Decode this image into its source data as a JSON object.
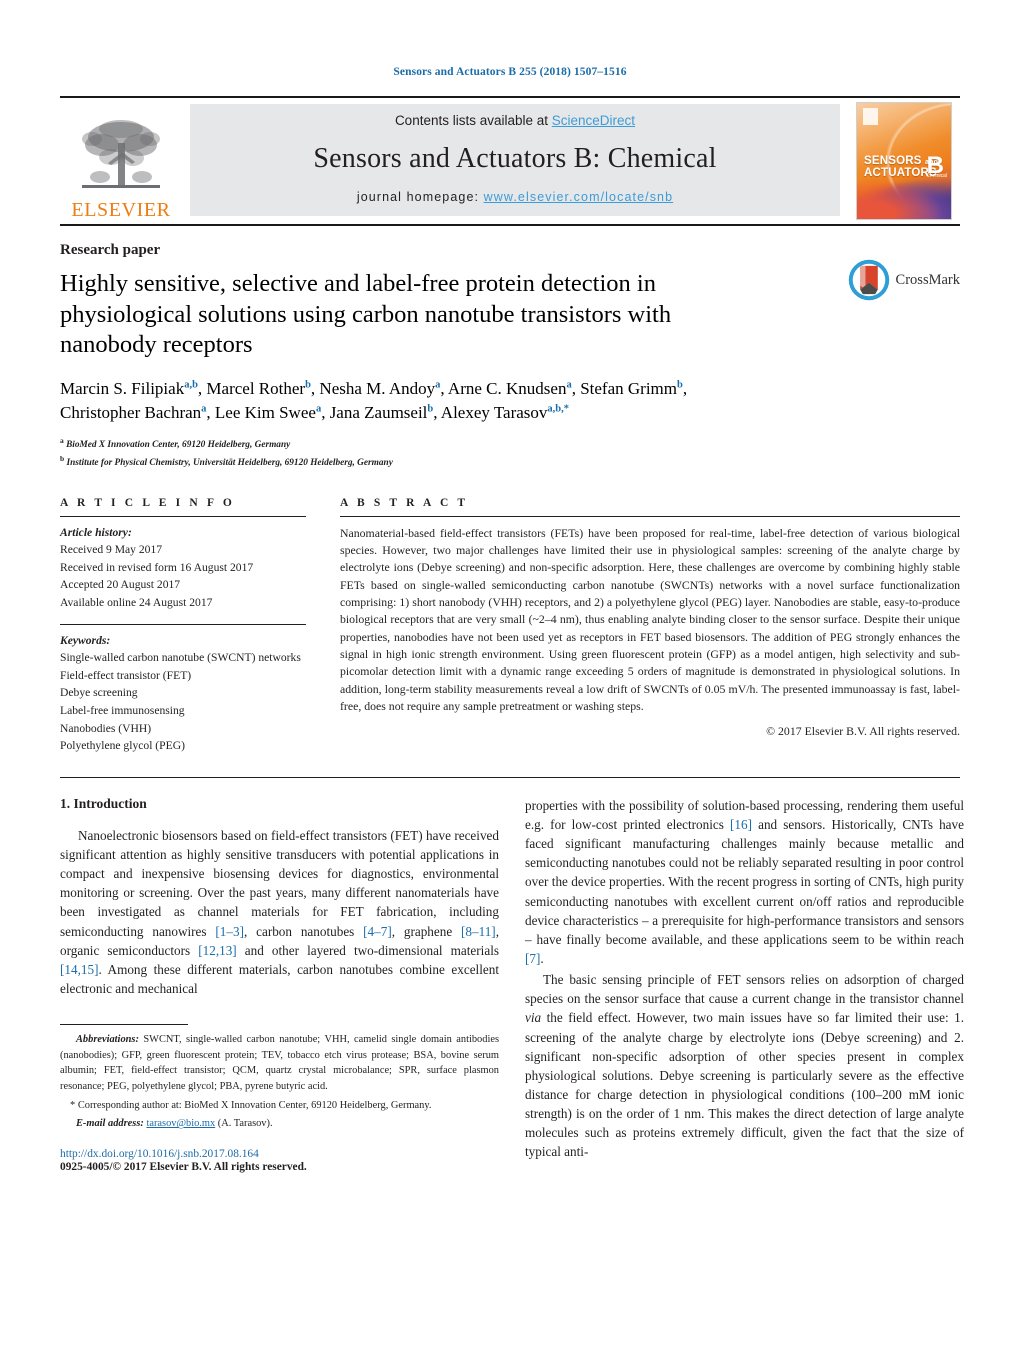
{
  "running_head": "Sensors and Actuators B 255 (2018) 1507–1516",
  "masthead": {
    "publisher": "ELSEVIER",
    "contents_prefix": "Contents lists available at ",
    "contents_link": "ScienceDirect",
    "journal_title": "Sensors and Actuators B: Chemical",
    "homepage_prefix": "journal homepage: ",
    "homepage_url": "www.elsevier.com/locate/snb",
    "cover": {
      "line1": "SENSORS",
      "line1_small": "and",
      "line2": "ACTUATORS",
      "letter": "B",
      "letter_sub": "Chemical"
    },
    "link_color": "#3c9cd7",
    "band_color": "#e6e7e8",
    "elsevier_orange": "#ee7d11"
  },
  "article": {
    "kind": "Research paper",
    "title": "Highly sensitive, selective and label-free protein detection in physiological solutions using carbon nanotube transistors with nanobody receptors",
    "crossmark_label": "CrossMark",
    "authors_html": "Marcin S. Filipiak<sup>a,b</sup>, Marcel Rother<sup>b</sup>, Nesha M. Andoy<sup>a</sup>, Arne C. Knudsen<sup>a</sup>, Stefan Grimm<sup>b</sup>, Christopher Bachran<sup>a</sup>, Lee Kim Swee<sup>a</sup>, Jana Zaumseil<sup>b</sup>, Alexey Tarasov<sup>a,b,<span>*</span></sup>",
    "affiliations": [
      "BioMed X Innovation Center, 69120 Heidelberg, Germany",
      "Institute for Physical Chemistry, Universität Heidelberg, 69120 Heidelberg, Germany"
    ],
    "affiliation_marks": [
      "a",
      "b"
    ]
  },
  "article_info": {
    "heading": "A R T I C L E   I N F O",
    "history_label": "Article history:",
    "history": [
      "Received 9 May 2017",
      "Received in revised form 16 August 2017",
      "Accepted 20 August 2017",
      "Available online 24 August 2017"
    ],
    "keywords_label": "Keywords:",
    "keywords": [
      "Single-walled carbon nanotube (SWCNT) networks",
      "Field-effect transistor (FET)",
      "Debye screening",
      "Label-free immunosensing",
      "Nanobodies (VHH)",
      "Polyethylene glycol (PEG)"
    ]
  },
  "abstract": {
    "heading": "A B S T R A C T",
    "text": "Nanomaterial-based field-effect transistors (FETs) have been proposed for real-time, label-free detection of various biological species. However, two major challenges have limited their use in physiological samples: screening of the analyte charge by electrolyte ions (Debye screening) and non-specific adsorption. Here, these challenges are overcome by combining highly stable FETs based on single-walled semiconducting carbon nanotube (SWCNTs) networks with a novel surface functionalization comprising: 1) short nanobody (VHH) receptors, and 2) a polyethylene glycol (PEG) layer. Nanobodies are stable, easy-to-produce biological receptors that are very small (~2–4 nm), thus enabling analyte binding closer to the sensor surface. Despite their unique properties, nanobodies have not been used yet as receptors in FET based biosensors. The addition of PEG strongly enhances the signal in high ionic strength environment. Using green fluorescent protein (GFP) as a model antigen, high selectivity and sub-picomolar detection limit with a dynamic range exceeding 5 orders of magnitude is demonstrated in physiological solutions. In addition, long-term stability measurements reveal a low drift of SWCNTs of 0.05 mV/h. The presented immunoassay is fast, label-free, does not require any sample pretreatment or washing steps.",
    "copyright": "© 2017 Elsevier B.V. All rights reserved."
  },
  "body": {
    "section_heading": "1.  Introduction",
    "para1_html": "Nanoelectronic biosensors based on field-effect transistors (FET) have received significant attention as highly sensitive transducers with potential applications in compact and inexpensive biosensing devices for diagnostics, environmental monitoring or screening. Over the past years, many different nanomaterials have been investigated as channel materials for FET fabrication, including semiconducting nanowires <span class=\"ref\">[1–3]</span>, carbon nanotubes <span class=\"ref\">[4–7]</span>, graphene <span class=\"ref\">[8–11]</span>, organic semiconductors <span class=\"ref\">[12,13]</span> and other layered two-dimensional materials <span class=\"ref\">[14,15]</span>. Among these different materials, carbon nanotubes combine excellent electronic and mechanical",
    "para2_html": "properties with the possibility of solution-based processing, rendering them useful e.g. for low-cost printed electronics <span class=\"ref\">[16]</span> and sensors. Historically, CNTs have faced significant manufacturing challenges mainly because metallic and semiconducting nanotubes could not be reliably separated resulting in poor control over the device properties. With the recent progress in sorting of CNTs, high purity semiconducting nanotubes with excellent current on/off ratios and reproducible device characteristics – a prerequisite for high-performance transistors and sensors – have finally become available, and these applications seem to be within reach <span class=\"ref\">[7]</span>.",
    "para3_html": "The basic sensing principle of FET sensors relies on adsorption of charged species on the sensor surface that cause a current change in the transistor channel <i>via</i> the field effect. However, two main issues have so far limited their use: 1. screening of the analyte charge by electrolyte ions (Debye screening) and 2. significant non-specific adsorption of other species present in complex physiological solutions. Debye screening is particularly severe as the effective distance for charge detection in physiological conditions (100–200 mM ionic strength) is on the order of 1 nm. This makes the direct detection of large analyte molecules such as proteins extremely difficult, given the fact that the size of typical anti-"
  },
  "footnotes": {
    "abbreviations_label": "Abbreviations:",
    "abbreviations_text": "SWCNT, single-walled carbon nanotube; VHH, camelid single domain antibodies (nanobodies); GFP, green fluorescent protein; TEV, tobacco etch virus protease; BSA, bovine serum albumin; FET, field-effect transistor; QCM, quartz crystal microbalance; SPR, surface plasmon resonance; PEG, polyethylene glycol; PBA, pyrene butyric acid.",
    "corresponding_mark": "*",
    "corresponding_text": "Corresponding author at: BioMed X Innovation Center, 69120 Heidelberg, Germany.",
    "email_label": "E-mail address:",
    "email": "tarasov@bio.mx",
    "email_owner": "(A. Tarasov).",
    "doi": "http://dx.doi.org/10.1016/j.snb.2017.08.164",
    "issn_line": "0925-4005/© 2017 Elsevier B.V. All rights reserved."
  }
}
